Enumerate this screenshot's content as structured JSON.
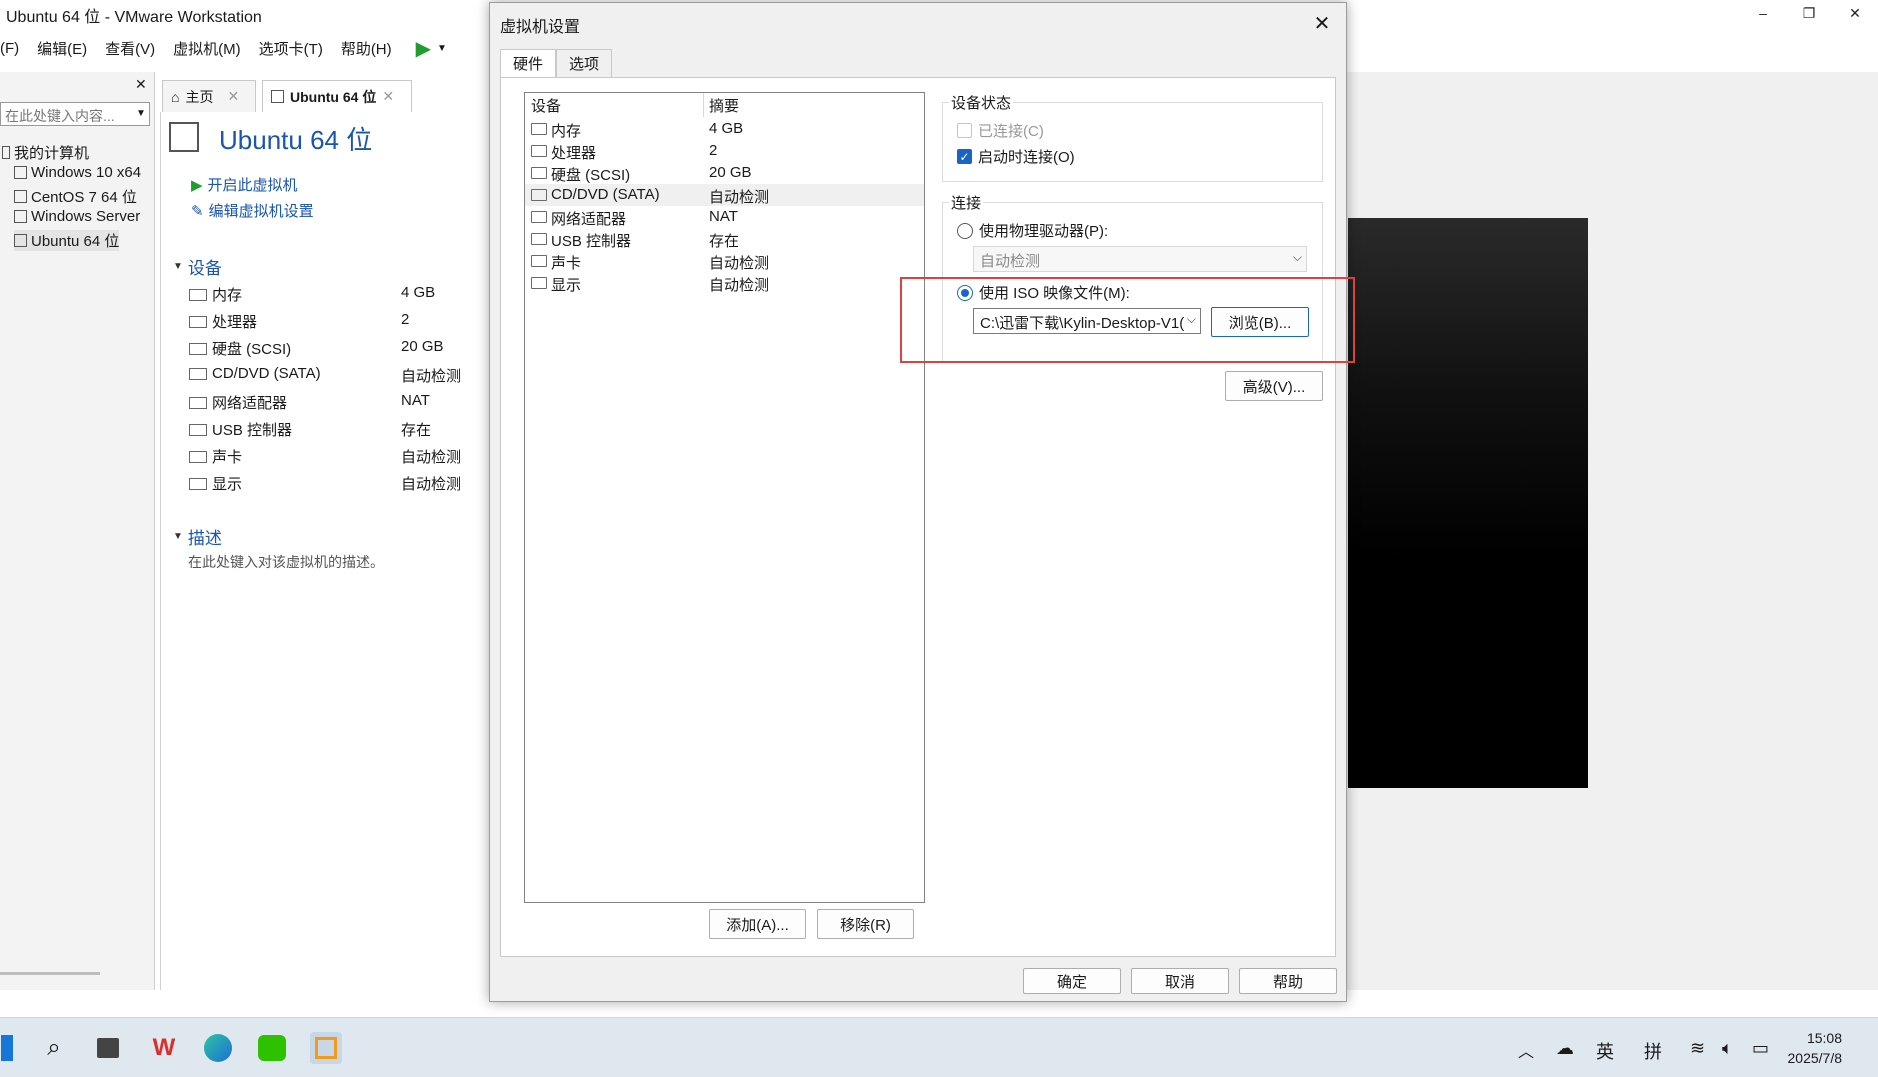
{
  "app": {
    "title": "Ubuntu 64 位 - VMware Workstation",
    "window_controls": [
      "–",
      "❐",
      "✕"
    ]
  },
  "menu": [
    "(F)",
    "编辑(E)",
    "查看(V)",
    "虚拟机(M)",
    "选项卡(T)",
    "帮助(H)"
  ],
  "library": {
    "search_placeholder": "在此处键入内容...",
    "root": "我的计算机",
    "items": [
      "Windows 10 x64",
      "CentOS 7 64 位",
      "Windows Server",
      "Ubuntu 64 位"
    ]
  },
  "tabs": [
    {
      "label": "主页"
    },
    {
      "label": "Ubuntu 64 位"
    }
  ],
  "summary": {
    "vm_name": "Ubuntu 64 位",
    "actions": [
      "开启此虚拟机",
      "编辑虚拟机设置"
    ],
    "devices_header": "设备",
    "devices": [
      {
        "name": "内存",
        "value": "4 GB"
      },
      {
        "name": "处理器",
        "value": "2"
      },
      {
        "name": "硬盘 (SCSI)",
        "value": "20 GB"
      },
      {
        "name": "CD/DVD (SATA)",
        "value": "自动检测"
      },
      {
        "name": "网络适配器",
        "value": "NAT"
      },
      {
        "name": "USB 控制器",
        "value": "存在"
      },
      {
        "name": "声卡",
        "value": "自动检测"
      },
      {
        "name": "显示",
        "value": "自动检测"
      }
    ],
    "desc_header": "描述",
    "desc_placeholder": "在此处键入对该虚拟机的描述。"
  },
  "dialog": {
    "title": "虚拟机设置",
    "close": "✕",
    "tabs": [
      "硬件",
      "选项"
    ],
    "list_headers": {
      "device": "设备",
      "summary": "摘要"
    },
    "devices": [
      {
        "name": "内存",
        "value": "4 GB"
      },
      {
        "name": "处理器",
        "value": "2"
      },
      {
        "name": "硬盘 (SCSI)",
        "value": "20 GB"
      },
      {
        "name": "CD/DVD (SATA)",
        "value": "自动检测"
      },
      {
        "name": "网络适配器",
        "value": "NAT"
      },
      {
        "name": "USB 控制器",
        "value": "存在"
      },
      {
        "name": "声卡",
        "value": "自动检测"
      },
      {
        "name": "显示",
        "value": "自动检测"
      }
    ],
    "add_button": "添加(A)...",
    "remove_button": "移除(R)",
    "device_status": {
      "label": "设备状态",
      "connected": "已连接(C)",
      "connect_on_start": "启动时连接(O)"
    },
    "connection": {
      "label": "连接",
      "physical": "使用物理驱动器(P):",
      "physical_value": "自动检测",
      "iso": "使用 ISO 映像文件(M):",
      "iso_path": "C:\\迅雷下载\\Kylin-Desktop-V1(",
      "browse": "浏览(B)..."
    },
    "advanced": "高级(V)...",
    "ok": "确定",
    "cancel": "取消",
    "help": "帮助"
  },
  "taskbar": {
    "tray_lang1": "英",
    "tray_lang2": "拼",
    "time": "15:08",
    "date": "2025/7/8"
  },
  "colors": {
    "accent": "#1a64c7",
    "highlight": "#e04040",
    "link": "#1a55b0"
  }
}
